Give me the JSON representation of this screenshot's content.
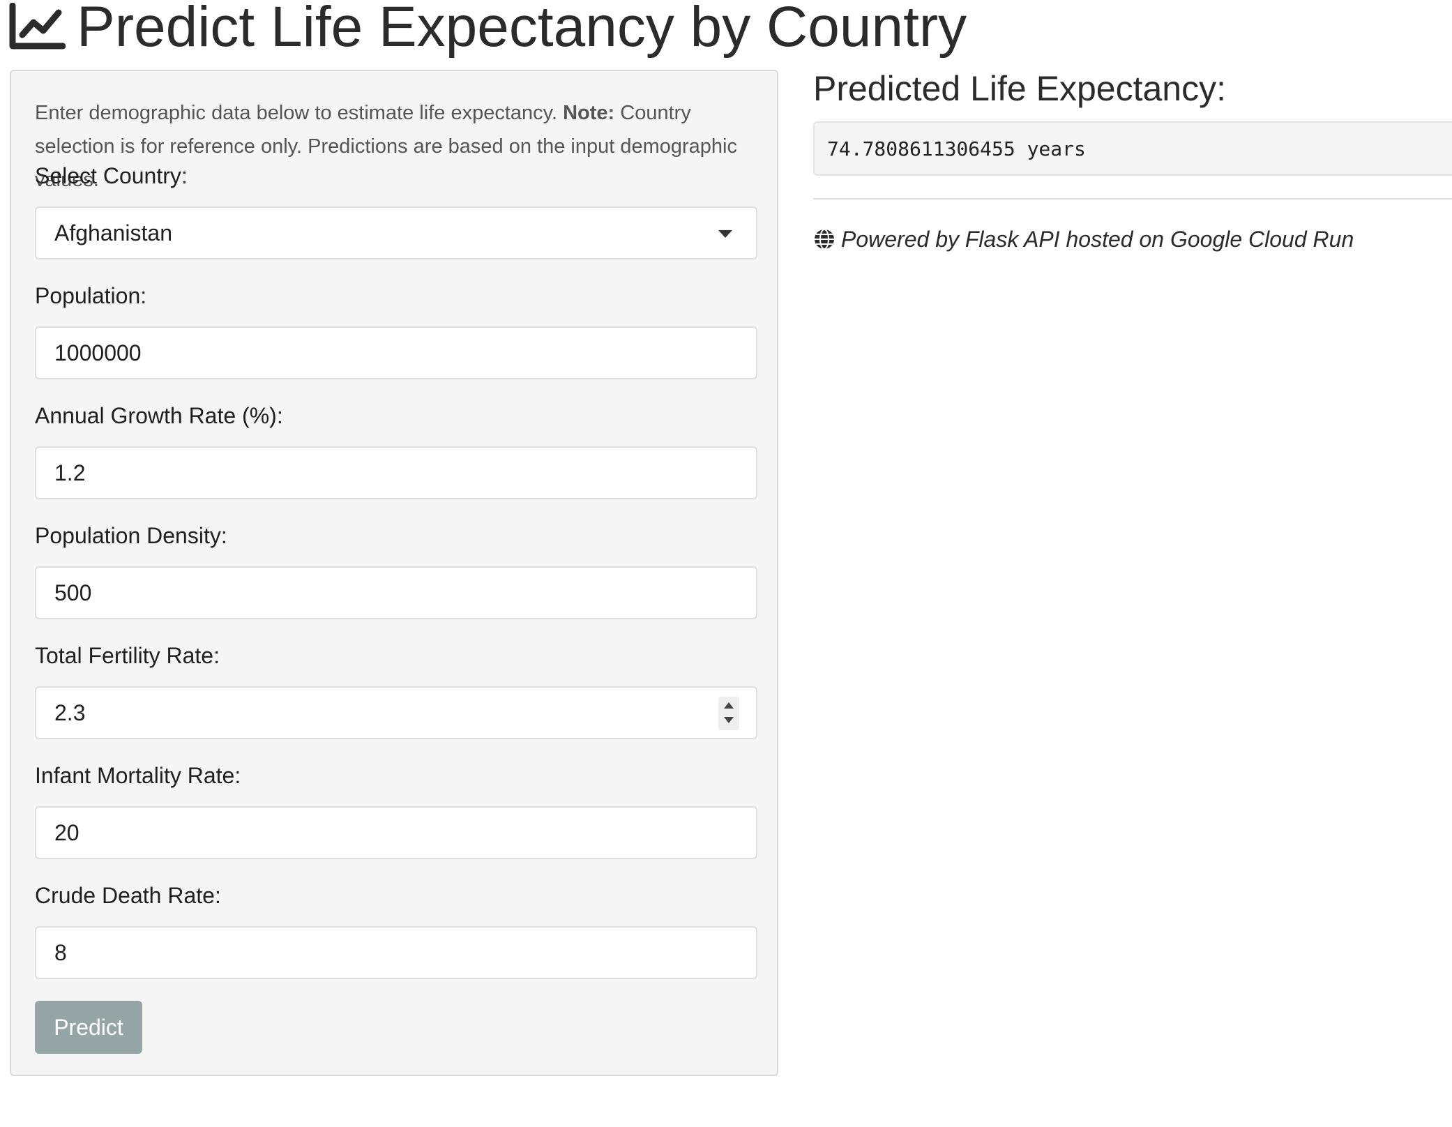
{
  "header": {
    "title": "Predict Life Expectancy by Country",
    "icon": "line-chart-icon"
  },
  "form": {
    "intro_text": "Enter demographic data below to estimate life expectancy.",
    "note_label": "Note:",
    "note_text": "Country selection is for reference only. Predictions are based on the input demographic values.",
    "country_label": "Select Country:",
    "country_value": "Afghanistan",
    "population_label": "Population:",
    "population_value": "1000000",
    "growth_label": "Annual Growth Rate (%):",
    "growth_value": "1.2",
    "density_label": "Population Density:",
    "density_value": "500",
    "fertility_label": "Total Fertility Rate:",
    "fertility_value": "2.3",
    "infant_label": "Infant Mortality Rate:",
    "infant_value": "20",
    "death_label": "Crude Death Rate:",
    "death_value": "8",
    "predict_label": "Predict"
  },
  "result": {
    "heading": "Predicted Life Expectancy:",
    "value": "74.7808611306455 years",
    "powered_by": "Powered by Flask API hosted on Google Cloud Run",
    "powered_icon": "globe-icon"
  },
  "colors": {
    "panel_bg": "#f5f5f5",
    "button_bg": "#95a5a6",
    "text": "#2b2b2b"
  }
}
